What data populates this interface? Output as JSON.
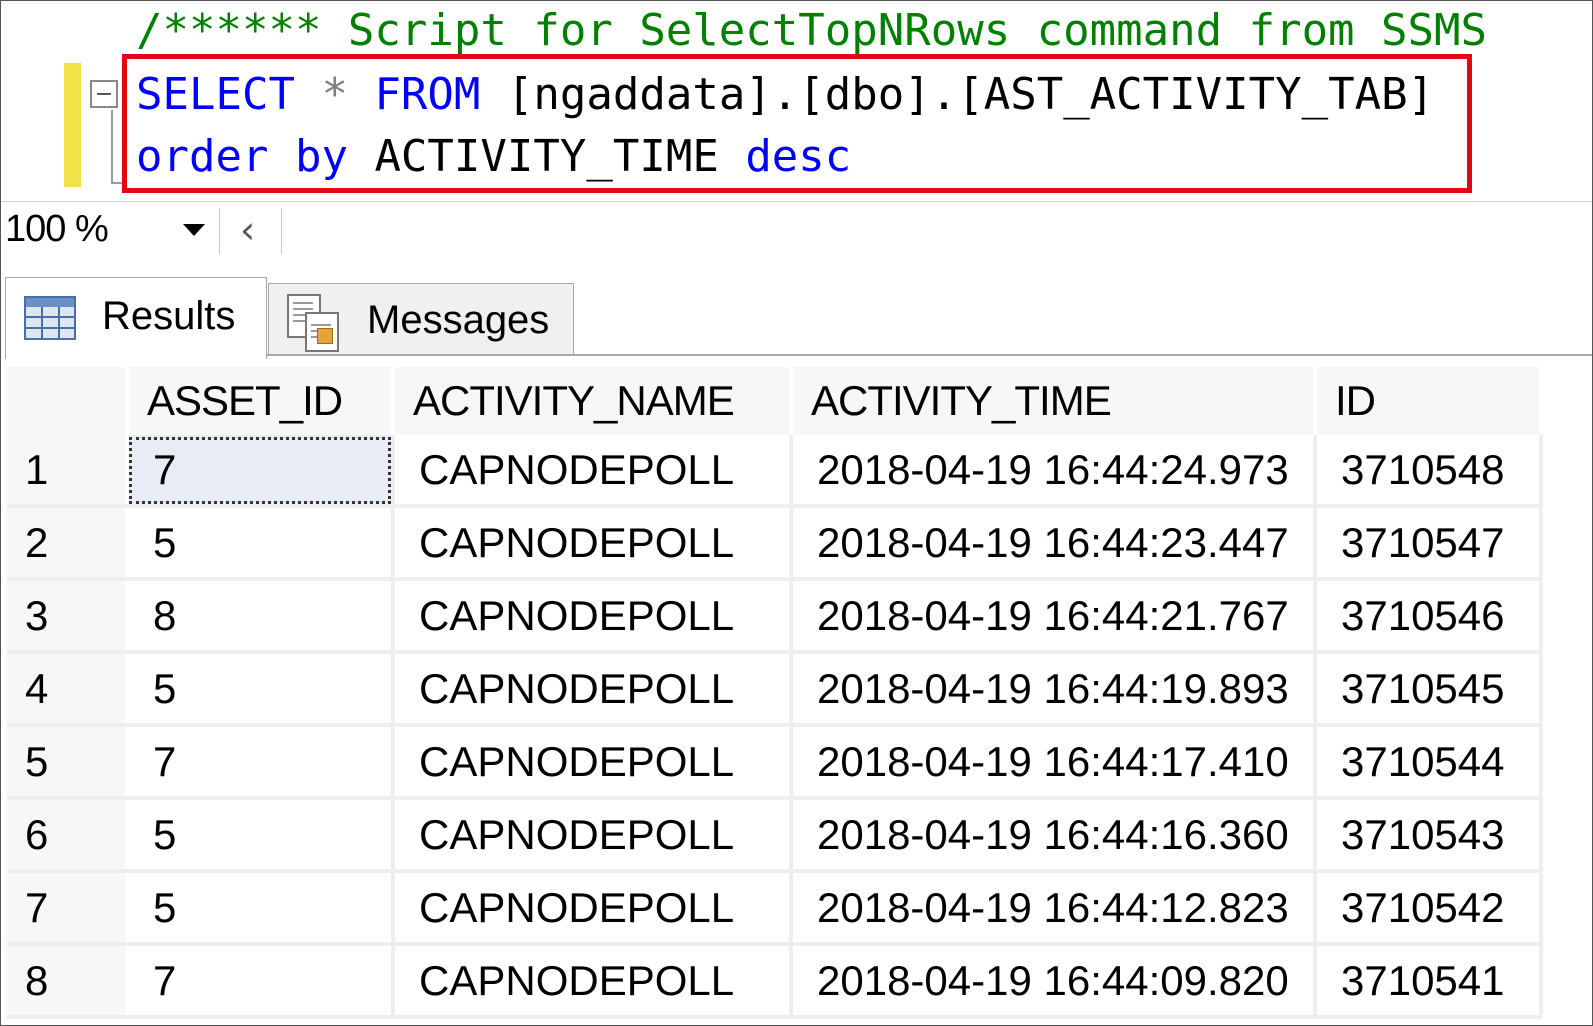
{
  "editor": {
    "comment_line": "/****** Script for SelectTopNRows command from SSMS",
    "line1": {
      "select_kw": "SELECT",
      "star": " * ",
      "from_kw": "FROM",
      "table": " [ngaddata].[dbo].[AST_ACTIVITY_TAB]"
    },
    "line2": {
      "order_kw": "order",
      "by_kw": "by",
      "column": "ACTIVITY_TIME",
      "desc_kw": "desc"
    }
  },
  "zoom": {
    "value": "100 %"
  },
  "tabs": {
    "results_label": "Results",
    "messages_label": "Messages"
  },
  "grid": {
    "columns": [
      "ASSET_ID",
      "ACTIVITY_NAME",
      "ACTIVITY_TIME",
      "ID"
    ],
    "rows": [
      {
        "num": "1",
        "asset_id": "7",
        "activity_name": "CAPNODEPOLL",
        "activity_time": "2018-04-19 16:44:24.973",
        "id": "3710548"
      },
      {
        "num": "2",
        "asset_id": "5",
        "activity_name": "CAPNODEPOLL",
        "activity_time": "2018-04-19 16:44:23.447",
        "id": "3710547"
      },
      {
        "num": "3",
        "asset_id": "8",
        "activity_name": "CAPNODEPOLL",
        "activity_time": "2018-04-19 16:44:21.767",
        "id": "3710546"
      },
      {
        "num": "4",
        "asset_id": "5",
        "activity_name": "CAPNODEPOLL",
        "activity_time": "2018-04-19 16:44:19.893",
        "id": "3710545"
      },
      {
        "num": "5",
        "asset_id": "7",
        "activity_name": "CAPNODEPOLL",
        "activity_time": "2018-04-19 16:44:17.410",
        "id": "3710544"
      },
      {
        "num": "6",
        "asset_id": "5",
        "activity_name": "CAPNODEPOLL",
        "activity_time": "2018-04-19 16:44:16.360",
        "id": "3710543"
      },
      {
        "num": "7",
        "asset_id": "5",
        "activity_name": "CAPNODEPOLL",
        "activity_time": "2018-04-19 16:44:12.823",
        "id": "3710542"
      },
      {
        "num": "8",
        "asset_id": "7",
        "activity_name": "CAPNODEPOLL",
        "activity_time": "2018-04-19 16:44:09.820",
        "id": "3710541"
      }
    ]
  },
  "colors": {
    "keyword": "#0000ff",
    "comment": "#008000",
    "highlight_border": "#e30613",
    "change_bar": "#f2e24a"
  }
}
